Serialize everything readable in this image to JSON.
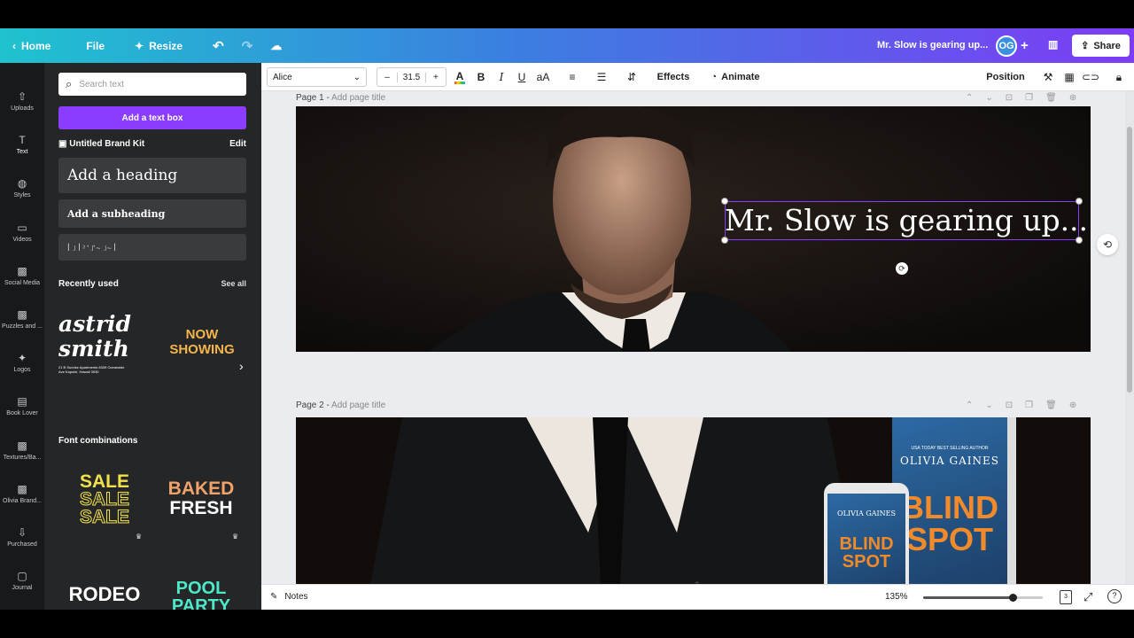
{
  "topbar": {
    "home": "Home",
    "file": "File",
    "resize": "Resize",
    "doc_title": "Mr. Slow is gearing up...",
    "avatar": "OG",
    "share": "Share"
  },
  "rail": [
    {
      "label": "Uploads",
      "icon": "upload-icon"
    },
    {
      "label": "Text",
      "icon": "text-icon"
    },
    {
      "label": "Styles",
      "icon": "palette-icon"
    },
    {
      "label": "Videos",
      "icon": "video-icon"
    },
    {
      "label": "Social Media",
      "icon": "image-thumb-icon"
    },
    {
      "label": "Puzzles and ...",
      "icon": "image-thumb-icon"
    },
    {
      "label": "Logos",
      "icon": "twitter-icon"
    },
    {
      "label": "Book Lover",
      "icon": "book-icon"
    },
    {
      "label": "Textures/Ba...",
      "icon": "image-thumb-icon"
    },
    {
      "label": "Olivia Brand...",
      "icon": "image-thumb-icon"
    },
    {
      "label": "Purchased",
      "icon": "download-icon"
    },
    {
      "label": "Journal",
      "icon": "journal-icon"
    }
  ],
  "panel": {
    "search_placeholder": "Search text",
    "add_textbox": "Add a text box",
    "brand_kit": "Untitled Brand Kit",
    "brand_edit": "Edit",
    "add_heading": "Add a heading",
    "add_subheading": "Add a subheading",
    "body_text": "ꟾ ꜌ ꟾ ꜅ ꜗ ꜌ꜗ ~ ꜌~ ꟾ",
    "recently_used": "Recently used",
    "see_all": "See all",
    "recent1_line1": "astrid",
    "recent1_line2": "smith",
    "recent1_small": "21 B Sunrise Apartments 8339 Oceanside Ave Kapolei, Hawaii 3930",
    "recent2_line1": "NOW",
    "recent2_line2": "SHOWING",
    "font_combinations": "Font combinations",
    "combo1": "SALE",
    "combo2_line1": "BAKED",
    "combo2_line2": "FRESH",
    "combo3": "RODEO",
    "combo4_line1": "POOL",
    "combo4_line2": "PARTY"
  },
  "toolbar": {
    "font": "Alice",
    "size": "31.5",
    "minus": "–",
    "plus": "+",
    "effects": "Effects",
    "animate": "Animate",
    "position": "Position"
  },
  "pages": [
    {
      "label": "Page 1 -",
      "subtitle": "Add page title"
    },
    {
      "label": "Page 2 -",
      "subtitle": "Add page title"
    }
  ],
  "page1": {
    "headline": "Mr. Slow is gearing up..."
  },
  "page2": {
    "book_author": "OLIVIA GAINES",
    "book_title_1": "BLIND",
    "book_title_2": "SPOT",
    "book_tag": "USA TODAY BEST SELLING AUTHOR",
    "phone_author": "OLIVIA GAINES",
    "phone_title_1": "BLIND",
    "phone_title_2": "SPOT"
  },
  "bottom": {
    "notes": "Notes",
    "zoom": "135%",
    "zoom_level": 0.75,
    "pages_count": "3"
  },
  "colors": {
    "accent": "#8b3dff",
    "rail_bg": "#18191b",
    "panel_bg": "#252627"
  }
}
